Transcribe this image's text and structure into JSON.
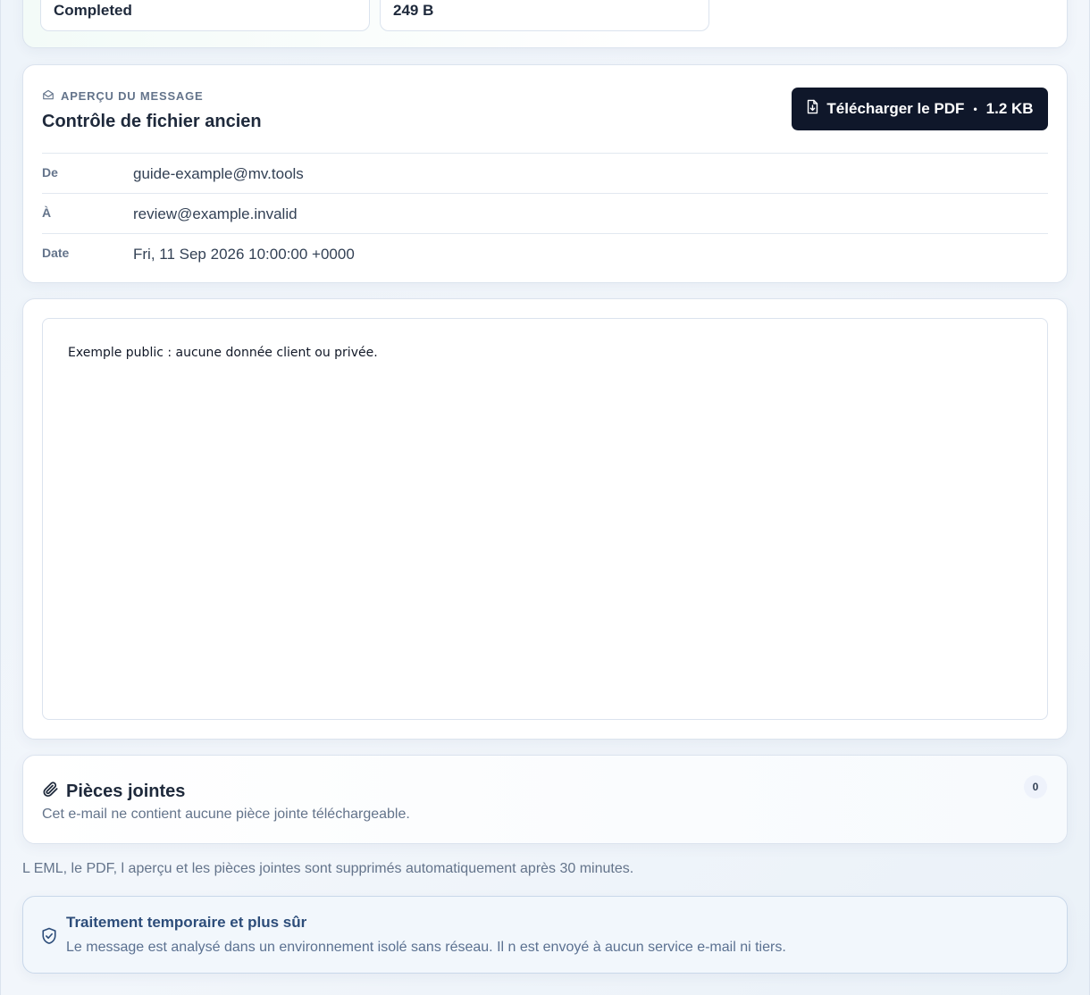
{
  "stats": {
    "status_value": "Completed",
    "size_value": "249 B"
  },
  "preview": {
    "eyebrow": "APERÇU DU MESSAGE",
    "subject": "Contrôle de fichier ancien",
    "download_label": "Télécharger le PDF",
    "download_size": "1.2 KB",
    "meta": [
      {
        "label": "De",
        "value": "guide-example@mv.tools"
      },
      {
        "label": "À",
        "value": "review@example.invalid"
      },
      {
        "label": "Date",
        "value": "Fri, 11 Sep 2026 10:00:00 +0000"
      }
    ]
  },
  "body": {
    "text": "Exemple public : aucune donnée client ou privée."
  },
  "attachments": {
    "title": "Pièces jointes",
    "subtitle": "Cet e-mail ne contient aucune pièce jointe téléchargeable.",
    "count": "0"
  },
  "retention_note": "L EML, le PDF, l aperçu et les pièces jointes sont supprimés automatiquement après 30 minutes.",
  "security": {
    "title": "Traitement temporaire et plus sûr",
    "text": "Le message est analysé dans un environnement isolé sans réseau. Il n est envoyé à aucun service e-mail ni tiers."
  },
  "colors": {
    "button_bg": "#0f172a",
    "accent": "#2d4d7a"
  }
}
